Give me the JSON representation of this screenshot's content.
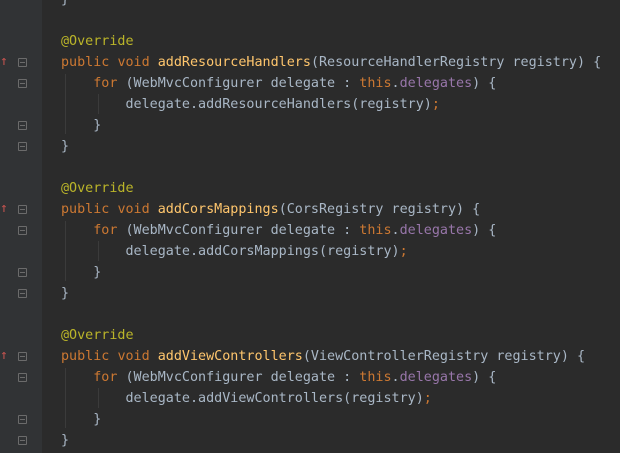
{
  "editor": {
    "annotation_text": "@Override",
    "keyword_public": "public",
    "keyword_void": "void",
    "keyword_for": "for",
    "keyword_this": "this",
    "field_name": "delegates",
    "loop_variable": "delegate",
    "loop_type": "WebMvcConfigurer",
    "methods": [
      {
        "name": "addResourceHandlers",
        "param_type": "ResourceHandlerRegistry",
        "param_name": "registry",
        "body_call": "delegate.addResourceHandlers(registry);"
      },
      {
        "name": "addCorsMappings",
        "param_type": "CorsRegistry",
        "param_name": "registry",
        "body_call": "delegate.addCorsMappings(registry);"
      },
      {
        "name": "addViewControllers",
        "param_type": "ViewControllerRegistry",
        "param_name": "registry",
        "body_call": "delegate.addViewControllers(registry);"
      }
    ]
  },
  "colors": {
    "background": "#2b2b2b",
    "gutter": "#313335",
    "default_text": "#a9b7c6",
    "keyword": "#cc7832",
    "method_name": "#ffc66d",
    "annotation": "#bbb529",
    "field": "#9876aa",
    "override_marker": "#c75450"
  },
  "icons": [
    "override-marker-icon",
    "fold-marker-icon"
  ]
}
